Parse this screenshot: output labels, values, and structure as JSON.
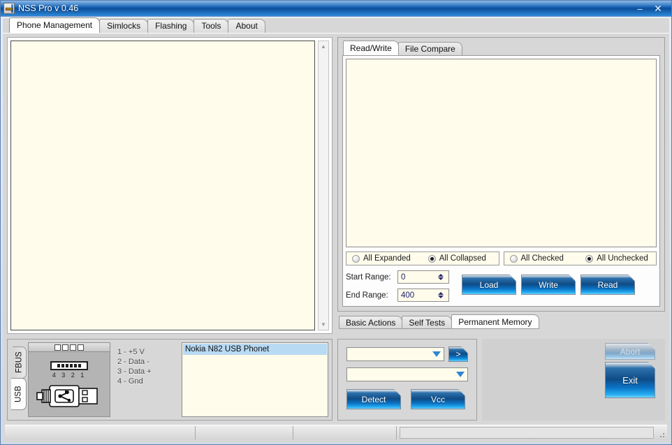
{
  "window": {
    "title": "NSS Pro v 0.46",
    "minimize_label": "–",
    "close_label": "✕"
  },
  "main_tabs": [
    {
      "label": "Phone Management",
      "active": true
    },
    {
      "label": "Simlocks",
      "active": false
    },
    {
      "label": "Flashing",
      "active": false
    },
    {
      "label": "Tools",
      "active": false
    },
    {
      "label": "About",
      "active": false
    }
  ],
  "log_panel": {
    "content": "",
    "scroll_up": "▲",
    "scroll_down": "▼"
  },
  "readwrite": {
    "tabs": [
      {
        "label": "Read/Write",
        "active": true
      },
      {
        "label": "File Compare",
        "active": false
      }
    ],
    "tree_content": "",
    "options_left": [
      {
        "label": "All Expanded",
        "selected": false
      },
      {
        "label": "All Collapsed",
        "selected": true
      }
    ],
    "options_right": [
      {
        "label": "All Checked",
        "selected": false
      },
      {
        "label": "All Unchecked",
        "selected": true
      }
    ],
    "start_range_label": "Start Range:",
    "start_range_value": "0",
    "end_range_label": "End Range:",
    "end_range_value": "400",
    "buttons": [
      {
        "label": "Load",
        "enabled": true
      },
      {
        "label": "Write",
        "enabled": true
      },
      {
        "label": "Read",
        "enabled": true
      }
    ]
  },
  "bottom_tabs": [
    {
      "label": "Basic Actions",
      "active": false
    },
    {
      "label": "Self Tests",
      "active": false
    },
    {
      "label": "Permanent Memory",
      "active": true
    }
  ],
  "connection": {
    "vertical_tabs": [
      {
        "label": "FBUS",
        "active": false
      },
      {
        "label": "USB",
        "active": true
      }
    ],
    "pin_numbers": "4 3 2 1",
    "legend": [
      "1 - +5 V",
      "2 - Data -",
      "3 - Data +",
      "4 - Gnd"
    ],
    "devices": [
      {
        "label": "Nokia N82 USB Phonet",
        "selected": true
      }
    ]
  },
  "controls": {
    "combo_top_value": "",
    "combo_bottom_value": "",
    "go_label": ">",
    "detect_label": "Detect",
    "vcc_label": "Vcc"
  },
  "actions": {
    "abort_label": "Abort",
    "abort_enabled": false,
    "exit_label": "Exit",
    "exit_enabled": true
  },
  "statusbar": {
    "cell1": "",
    "cell2": "",
    "cell3": "",
    "progress": ""
  },
  "colors": {
    "title_blue": "#0d5aad",
    "button_blue": "#0e4c86",
    "panel_gray": "#d7d7d7",
    "field_cream": "#fffceb",
    "selection_blue": "#b8daf3"
  }
}
